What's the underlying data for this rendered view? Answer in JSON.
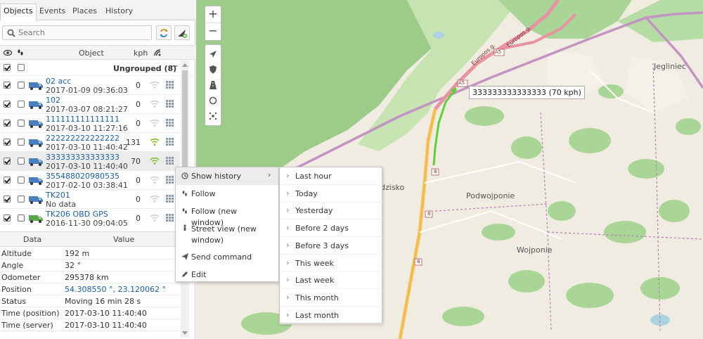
{
  "tabs": [
    "Objects",
    "Events",
    "Places",
    "History"
  ],
  "search": {
    "placeholder": "Search"
  },
  "objects_header": {
    "object": "Object",
    "kph": "kph"
  },
  "group": {
    "label": "Ungrouped (8)",
    "collapse": "−"
  },
  "objects": [
    {
      "name": "02 acc",
      "time": "2017-01-09 09:36:03",
      "speed": "0",
      "truck_color": "#4a7fbf",
      "signal": "off"
    },
    {
      "name": "102",
      "time": "2017-03-07 08:21:27",
      "speed": "0",
      "truck_color": "#4a7fbf",
      "signal": "off"
    },
    {
      "name": "111111111111111",
      "time": "2017-03-10 11:27:16",
      "speed": "0",
      "truck_color": "#4a7fbf",
      "signal": "off"
    },
    {
      "name": "222222222222222",
      "time": "2017-03-10 11:40:42",
      "speed": "131",
      "truck_color": "#4a7fbf",
      "signal": "on"
    },
    {
      "name": "333333333333333",
      "time": "2017-03-10 11:40:40",
      "speed": "70",
      "truck_color": "#4a7fbf",
      "signal": "on"
    },
    {
      "name": "355488020980535",
      "time": "2017-02-10 03:38:41",
      "speed": "0",
      "truck_color": "#4a7fbf",
      "signal": "off"
    },
    {
      "name": "TK201",
      "time": "No data",
      "speed": "0",
      "truck_color": "#4a7fbf",
      "signal": "off"
    },
    {
      "name": "TK206 OBD GPS",
      "time": "2016-11-30 09:04:05",
      "speed": "0",
      "truck_color": "#5aa84a",
      "signal": "off"
    }
  ],
  "details_header": {
    "data": "Data",
    "value": "Value"
  },
  "details": [
    {
      "key": "Altitude",
      "value": "192 m"
    },
    {
      "key": "Angle",
      "value": "32 °"
    },
    {
      "key": "Odometer",
      "value": "295378 km"
    },
    {
      "key": "Position",
      "value": "54.308550 °, 23.120062 °"
    },
    {
      "key": "Status",
      "value": "Moving 16 min 28 s"
    },
    {
      "key": "Time (position)",
      "value": "2017-03-10 11:40:40"
    },
    {
      "key": "Time (server)",
      "value": "2017-03-10 11:40:40"
    }
  ],
  "map": {
    "zoom_in": "+",
    "zoom_out": "−",
    "tooltip": "333333333333333 (70 kph)",
    "places": [
      "Jegliniec",
      "Podwojponie",
      "Wojponie",
      "dzisko"
    ],
    "road_labels": [
      "A5",
      "A5",
      "8",
      "8",
      "8",
      "Europos g.",
      "Europos g."
    ]
  },
  "context_menu": [
    {
      "label": "Show history",
      "icon": "history-icon",
      "has_sub": true
    },
    {
      "label": "Follow",
      "icon": "follow-icon"
    },
    {
      "label": "Follow (new window)",
      "icon": "follow-window-icon"
    },
    {
      "label": "Street view (new window)",
      "icon": "street-view-icon"
    },
    {
      "label": "Send command",
      "icon": "send-icon"
    },
    {
      "label": "Edit",
      "icon": "edit-icon"
    }
  ],
  "history_menu": [
    "Last hour",
    "Today",
    "Yesterday",
    "Before 2 days",
    "Before 3 days",
    "This week",
    "Last week",
    "This month",
    "Last month"
  ],
  "colors": {
    "link": "#1a5fa8",
    "route": "#5ed13a",
    "forest": "#9dcc8a",
    "boundary": "#b77ab8"
  }
}
